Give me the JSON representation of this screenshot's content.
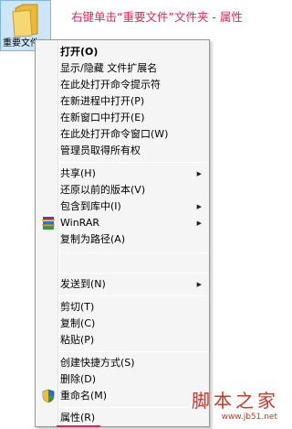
{
  "desktop": {
    "folder_label": "重要文件"
  },
  "caption": "右键单击“重要文件”文件夹 - 属性",
  "menu": {
    "items": [
      {
        "label": "打开(O)"
      },
      {
        "label": "显示/隐藏 文件扩展名"
      },
      {
        "label": "在此处打开命令提示符"
      },
      {
        "label": "在新进程中打开(P)"
      },
      {
        "label": "在新窗口中打开(E)"
      },
      {
        "label": "在此处打开命令窗口(W)"
      },
      {
        "label": "管理员取得所有权"
      },
      {
        "label": "共享(H)"
      },
      {
        "label": "还原以前的版本(V)"
      },
      {
        "label": "包含到库中(I)"
      },
      {
        "label": "WinRAR"
      },
      {
        "label": "复制为路径(A)"
      },
      {
        "label": "发送到(N)"
      },
      {
        "label": "剪切(T)"
      },
      {
        "label": "复制(C)"
      },
      {
        "label": "粘贴(P)"
      },
      {
        "label": "创建快捷方式(S)"
      },
      {
        "label": "删除(D)"
      },
      {
        "label": "重命名(M)"
      },
      {
        "label": "属性(R)"
      }
    ]
  },
  "watermark": {
    "title": "脚本之家",
    "url": "www.jb51.net"
  },
  "colors": {
    "caption": "#e0245a",
    "highlight_underline": "#e0245a",
    "menu_bg": "#f5f5f5",
    "watermark": "#c0392b"
  },
  "icons": {
    "folder": "folder-icon",
    "winrar": "winrar-icon",
    "shield": "uac-shield-icon",
    "submenu": "submenu-arrow-icon"
  }
}
